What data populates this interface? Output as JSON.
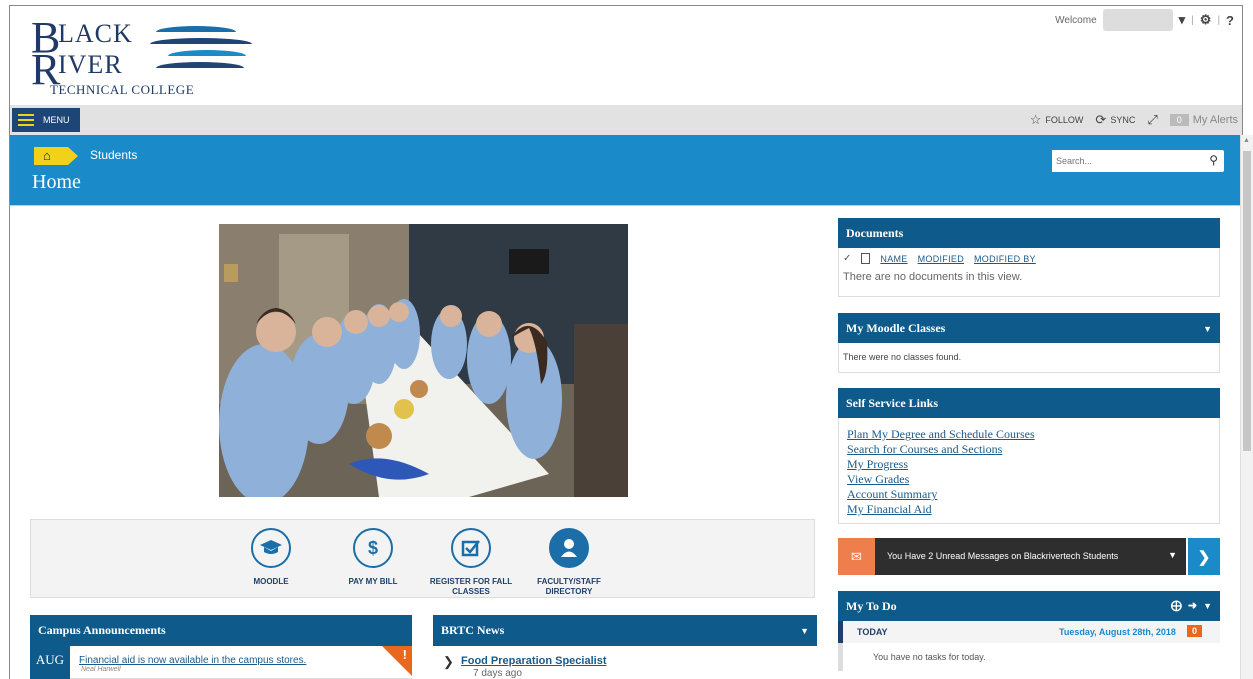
{
  "brand": {
    "logo_text_line1": "BLACK",
    "logo_text_line2": "RIVER",
    "logo_text_line3": "TECHNICAL COLLEGE",
    "primary_color": "#1b8ac9",
    "dark_color": "#0e5a8a",
    "accent_color": "#f2d11a"
  },
  "user_bar": {
    "welcome_label": "Welcome",
    "dropdown_icon": "chevron-down-icon",
    "settings_icon": "gear-icon",
    "help_label": "?"
  },
  "suite": {
    "menu_label": "MENU",
    "follow_label": "FOLLOW",
    "sync_label": "SYNC",
    "alerts_count": "0",
    "alerts_label": "My Alerts"
  },
  "title_band": {
    "breadcrumb": "Students",
    "page_title": "Home",
    "search_placeholder": "Search..."
  },
  "quick_links": [
    {
      "label": "MOODLE",
      "icon": "graduation-cap-icon"
    },
    {
      "label": "PAY MY BILL",
      "icon": "dollar-icon"
    },
    {
      "label": "REGISTER FOR FALL CLASSES",
      "icon": "checkbox-icon"
    },
    {
      "label": "FACULTY/STAFF DIRECTORY",
      "icon": "person-icon"
    }
  ],
  "announcements": {
    "title": "Campus Announcements",
    "month": "AUG",
    "item_title": "Financial aid is now available in the campus stores.",
    "item_author": "Neal Harwell",
    "flag": "!"
  },
  "news": {
    "title": "BRTC News",
    "item_title": "Food Preparation Specialist",
    "item_time": "7 days ago"
  },
  "documents": {
    "title": "Documents",
    "columns": [
      "NAME",
      "MODIFIED",
      "MODIFIED BY"
    ],
    "empty_text": "There are no documents in this view."
  },
  "moodle": {
    "title": "My Moodle Classes",
    "empty_text": "There were no classes found."
  },
  "self_service": {
    "title": "Self Service Links",
    "links": [
      "Plan My Degree and Schedule Courses",
      "Search for Courses and Sections",
      "My Progress",
      "View Grades",
      "Account Summary",
      "My Financial Aid"
    ]
  },
  "messages": {
    "text": "You Have 2 Unread Messages on Blackrivertech Students"
  },
  "todo": {
    "title": "My To Do",
    "today_label": "TODAY",
    "date": "Tuesday, August 28th, 2018",
    "count": "0",
    "empty_text": "You have no tasks for today."
  }
}
